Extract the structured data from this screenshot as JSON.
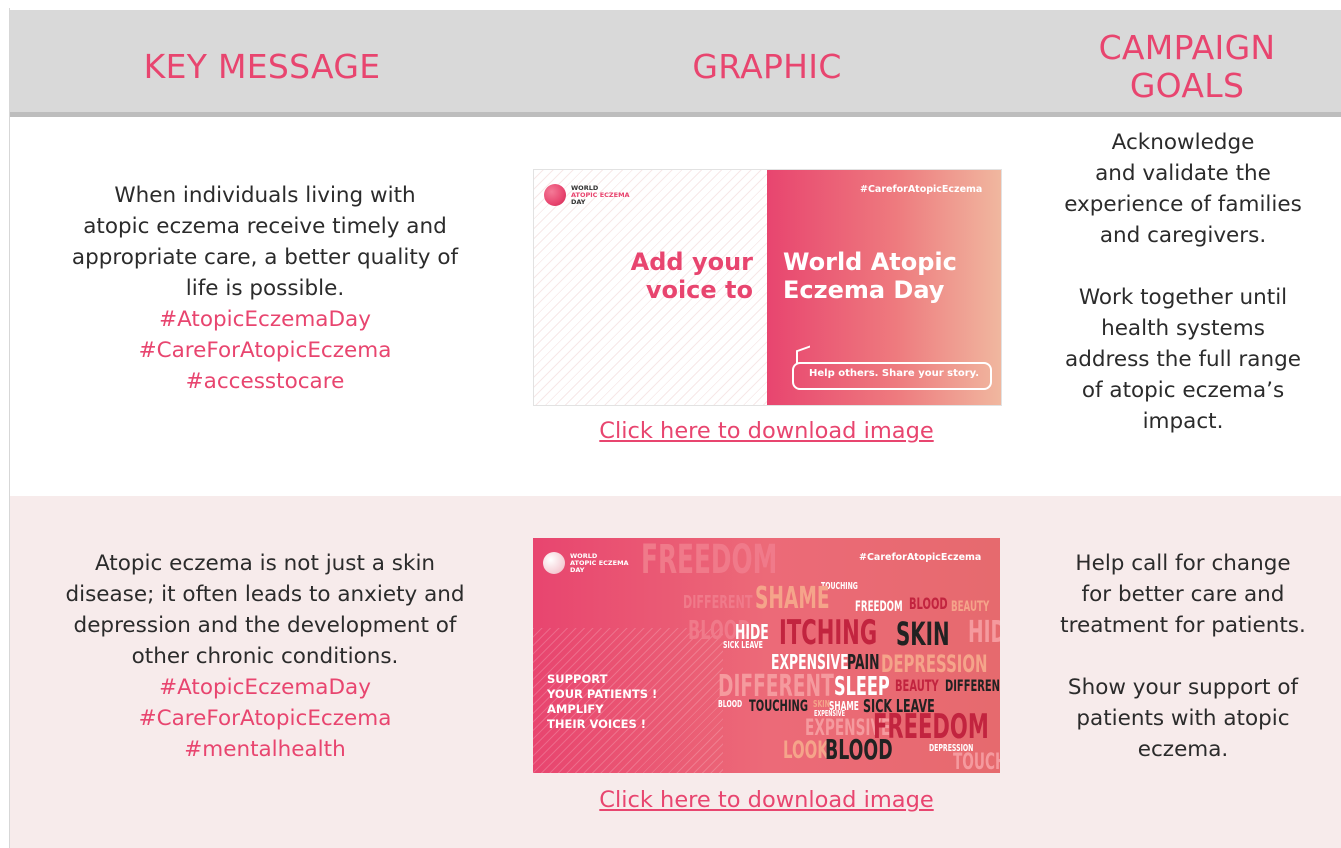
{
  "header": {
    "col1": "KEY MESSAGE",
    "col2": "GRAPHIC",
    "col3_line1": "CAMPAIGN",
    "col3_line2": "GOALS"
  },
  "rows": [
    {
      "message": [
        "When individuals living with",
        "atopic eczema receive timely and",
        "appropriate care, a better quality of",
        "life is possible."
      ],
      "hashtags": [
        "#AtopicEczemaDay",
        "#CareForAtopicEczema",
        "#accesstocare"
      ],
      "link": "Click here to download image",
      "goals": [
        [
          "Acknowledge",
          "and validate the",
          "experience of families",
          "and caregivers."
        ],
        [
          "Work together until",
          "health systems",
          "address the full range",
          "of atopic eczema’s",
          "impact."
        ]
      ],
      "graphic": {
        "logo": [
          "WORLD",
          "ATOPIC ECZEMA",
          "DAY"
        ],
        "hashtag": "#CareforAtopicEczema",
        "left_line1": "Add your",
        "left_line2": "voice to",
        "right_line1": "World Atopic",
        "right_line2": "Eczema Day",
        "bubble": "Help others. Share your story."
      }
    },
    {
      "message": [
        "Atopic eczema is not just a skin",
        "disease; it often leads to anxiety and",
        "depression and the development of",
        "other chronic conditions."
      ],
      "hashtags": [
        "#AtopicEczemaDay",
        "#CareForAtopicEczema",
        "#mentalhealth"
      ],
      "link": "Click here to download image",
      "goals": [
        [
          "Help call for change",
          "for better care and",
          "treatment for patients."
        ],
        [
          "Show your support of",
          "patients with atopic",
          "eczema."
        ]
      ],
      "graphic": {
        "logo": [
          "WORLD",
          "ATOPIC ECZEMA",
          "DAY"
        ],
        "hashtag": "#CareforAtopicEczema",
        "support": [
          "SUPPORT",
          "YOUR PATIENTS !",
          "AMPLIFY",
          "THEIR VOICES !"
        ],
        "words": [
          "FREEDOM",
          "TOUCHING",
          "DIFFERENT",
          "SHAME",
          "FREEDOM",
          "BLOOD",
          "BEAUTY",
          "BLOOD",
          "HIDE",
          "ITCHING",
          "SKIN",
          "HIDE",
          "SICK LEAVE",
          "EXPENSIVE",
          "PAIN",
          "DEPRESSION",
          "DIFFERENT",
          "SLEEP",
          "BEAUTY",
          "DIFFERENT",
          "BLOOD",
          "TOUCHING",
          "SKIN",
          "SHAME",
          "SICK LEAVE",
          "EXPENSIVE",
          "EXPENSIVE",
          "FREEDOM",
          "LOOK",
          "BLOOD",
          "DEPRESSION",
          "TOUCHING"
        ]
      }
    }
  ],
  "colors": {
    "accent": "#e8456f",
    "header_bg": "#d9d9d9",
    "row2_bg": "#f7ebeb"
  }
}
